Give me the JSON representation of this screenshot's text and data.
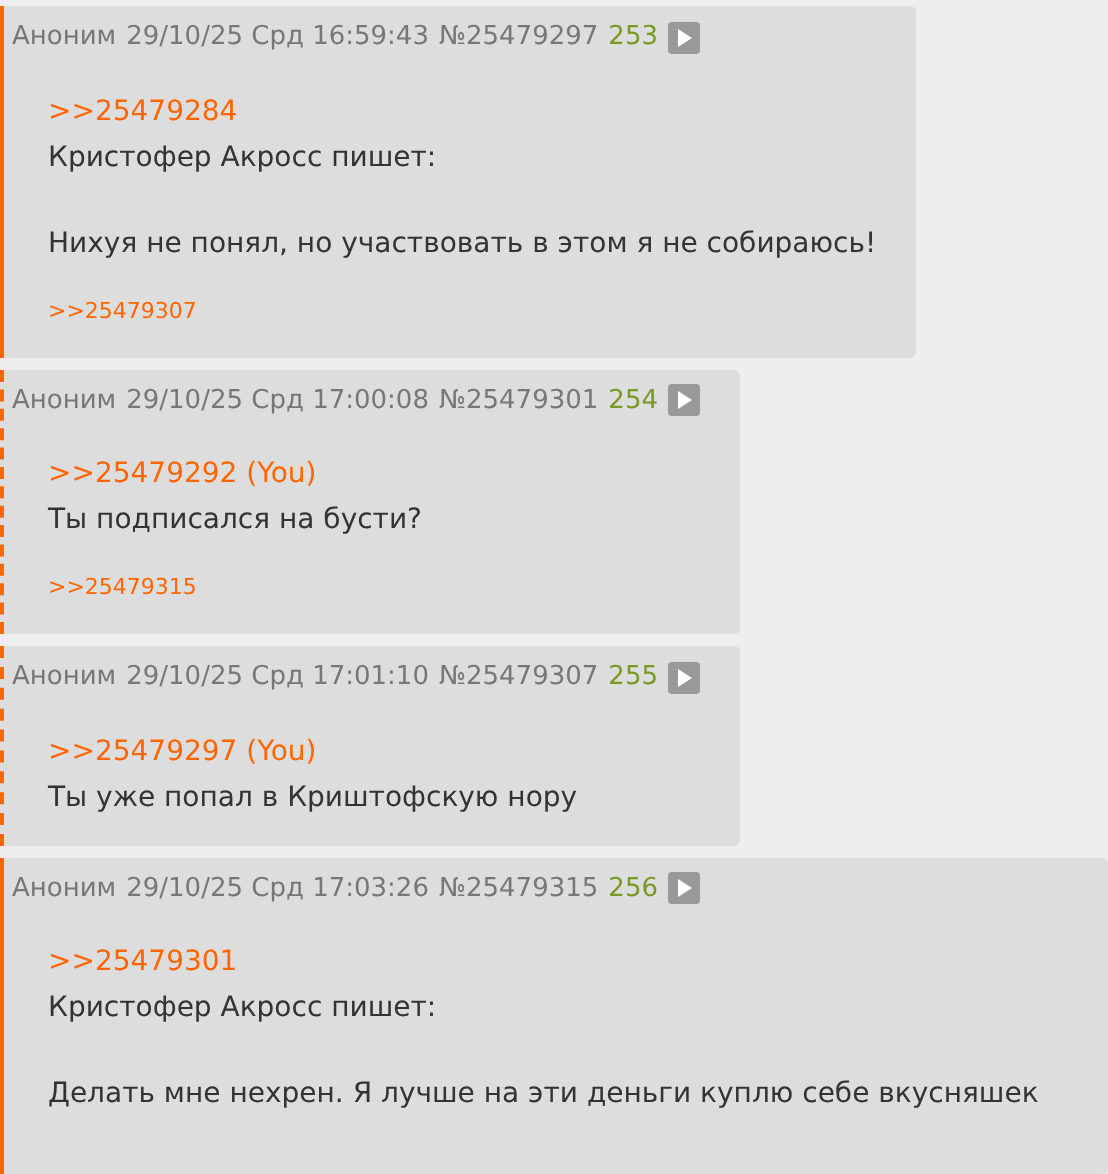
{
  "posts": [
    {
      "dashed": false,
      "name": "Аноним",
      "date": "29/10/25 Срд 16:59:43",
      "number": "№25479297",
      "index": "253",
      "quote": ">>25479284",
      "paragraphs": [
        "Кристофер Акросс пишет:",
        "Нихуя не понял, но участвовать в этом я не собираюсь!"
      ],
      "replies": [
        ">>25479307"
      ]
    },
    {
      "dashed": true,
      "name": "Аноним",
      "date": "29/10/25 Срд 17:00:08",
      "number": "№25479301",
      "index": "254",
      "quote": ">>25479292 (You)",
      "paragraphs": [
        "Ты подписался на бусти?"
      ],
      "replies": [
        ">>25479315"
      ]
    },
    {
      "dashed": true,
      "name": "Аноним",
      "date": "29/10/25 Срд 17:01:10",
      "number": "№25479307",
      "index": "255",
      "quote": ">>25479297 (You)",
      "paragraphs": [
        "Ты уже попал в Криштофскую нору"
      ]
    },
    {
      "dashed": false,
      "name": "Аноним",
      "date": "29/10/25 Срд 17:03:26",
      "number": "№25479315",
      "index": "256",
      "quote": ">>25479301",
      "paragraphs": [
        "Кристофер Акросс пишет:",
        "Делать мне нехрен. Я лучше на эти деньги куплю себе вкусняшек"
      ]
    }
  ]
}
